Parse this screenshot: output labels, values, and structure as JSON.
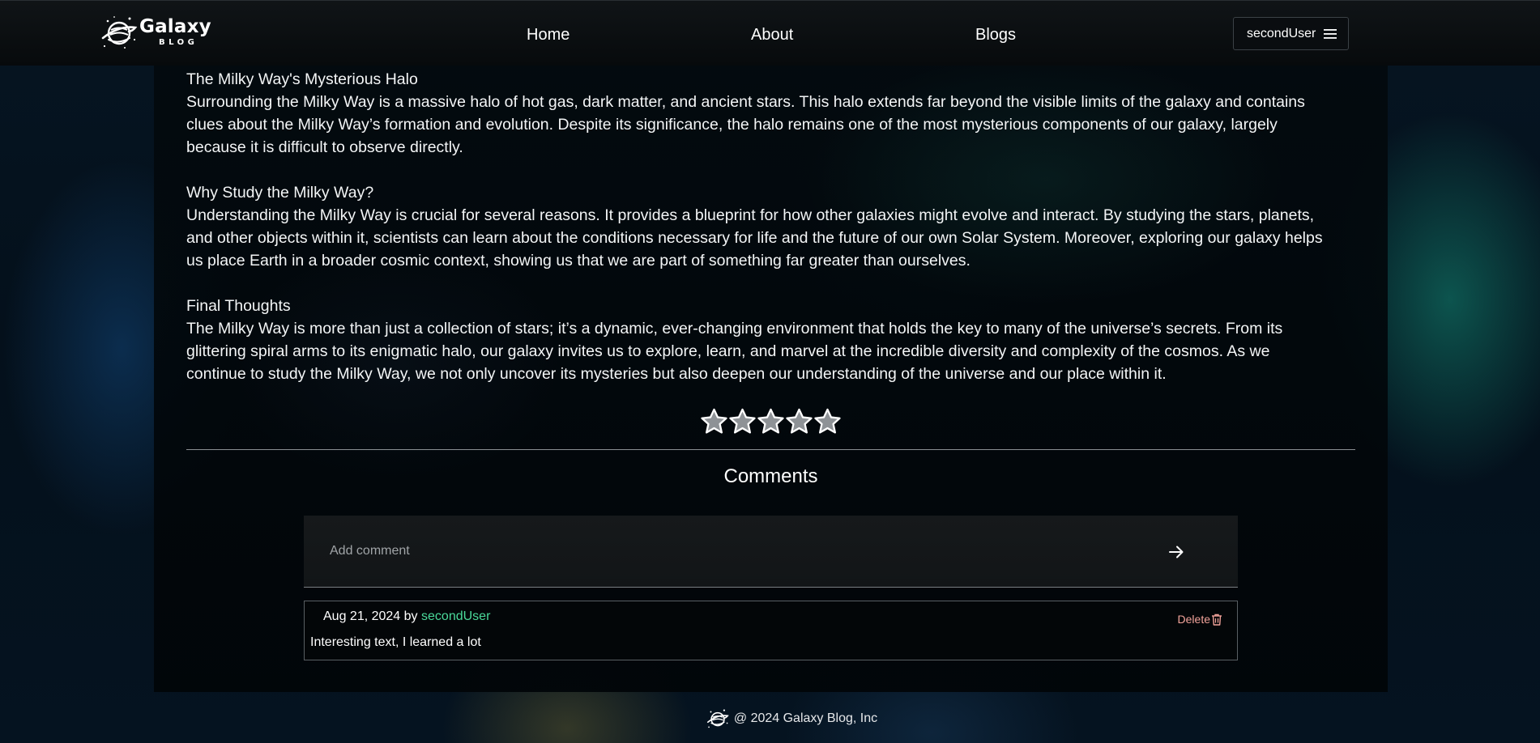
{
  "header": {
    "logo_title": "Galaxy",
    "logo_subtitle": "BLOG",
    "nav": [
      {
        "label": "Home"
      },
      {
        "label": "About"
      },
      {
        "label": "Blogs"
      }
    ],
    "user_menu": {
      "username": "secondUser",
      "icon": "hamburger-menu-icon"
    }
  },
  "article": {
    "sections": [
      {
        "heading": "The Milky Way's Mysterious Halo",
        "lines": [
          "Surrounding the Milky Way is a massive halo of hot gas, dark matter, and ancient stars. This halo extends far beyond the visible limits of the galaxy and contains",
          "clues about the Milky Way’s formation and evolution. Despite its significance, the halo remains one of the most mysterious components of our galaxy, largely",
          "because it is difficult to observe directly."
        ]
      },
      {
        "heading": "Why Study the Milky Way?",
        "lines": [
          "Understanding the Milky Way is crucial for several reasons. It provides a blueprint for how other galaxies might evolve and interact. By studying the stars, planets,",
          "and other objects within it, scientists can learn about the conditions necessary for life and the future of our own Solar System. Moreover, exploring our galaxy helps",
          "us place Earth in a broader cosmic context, showing us that we are part of something far greater than ourselves."
        ]
      },
      {
        "heading": "Final Thoughts",
        "lines": [
          "The Milky Way is more than just a collection of stars; it’s a dynamic, ever-changing environment that holds the key to many of the universe’s secrets. From its",
          "glittering spiral arms to its enigmatic halo, our galaxy invites us to explore, learn, and marvel at the incredible diversity and complexity of the cosmos. As we",
          "continue to study the Milky Way, we not only uncover its mysteries but also deepen our understanding of the universe and our place within it."
        ]
      }
    ]
  },
  "rating": {
    "max": 5,
    "value": 0,
    "icon": "star-icon"
  },
  "comments": {
    "title": "Comments",
    "input_placeholder": "Add comment",
    "send_icon": "arrow-right-icon",
    "items": [
      {
        "date": "Aug 21, 2024",
        "by": "by",
        "author": "secondUser",
        "text": "Interesting text, I learned a lot",
        "delete_label": "Delete",
        "delete_icon": "trash-icon"
      }
    ]
  },
  "footer": {
    "text": "@ 2024 Galaxy Blog, Inc",
    "icon": "galaxy-logo-icon"
  },
  "colors": {
    "author_link": "#4ad99a",
    "delete": "#f2a39a",
    "background": "#04101b"
  }
}
